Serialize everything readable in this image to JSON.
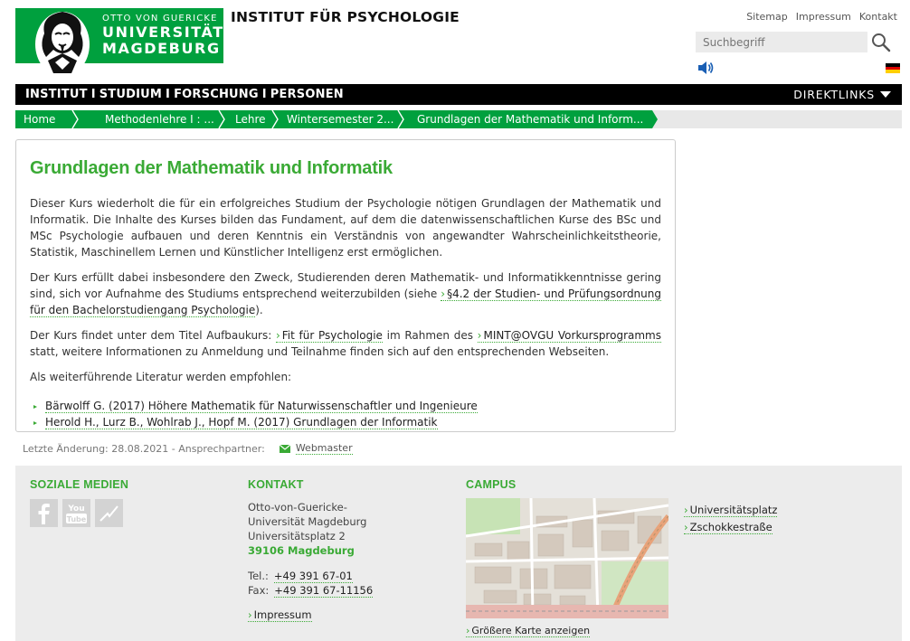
{
  "header": {
    "logo_line1": "OTTO VON GUERICKE",
    "logo_line2": "UNIVERSITÄT",
    "logo_line3": "MAGDEBURG",
    "institute_title": "INSTITUT FÜR PSYCHOLOGIE",
    "toplinks": [
      "Sitemap",
      "Impressum",
      "Kontakt"
    ],
    "search_placeholder": "Suchbegriff"
  },
  "nav": {
    "items": [
      "INSTITUT",
      "STUDIUM",
      "FORSCHUNG",
      "PERSONEN"
    ],
    "separator": "I",
    "direktlinks": "DIREKTLINKS"
  },
  "breadcrumb": [
    "Home",
    "Methodenlehre I : ...",
    "Lehre",
    "Wintersemester 2...",
    "Grundlagen der Mathematik und Inform..."
  ],
  "content": {
    "title": "Grundlagen der Mathematik und Informatik",
    "p1": "Dieser Kurs wiederholt die für ein erfolgreiches Studium der Psychologie nötigen Grundlagen der Mathematik und Informatik. Die Inhalte des Kurses bilden das Fundament, auf dem die datenwissenschaftlichen Kurse des BSc und MSc Psychologie aufbauen und deren Kenntnis ein Verständnis von angewandter Wahrscheinlichkeitstheorie, Statistik, Maschinellem Lernen und Künstlicher Intelligenz erst ermöglichen.",
    "p2_before": "Der Kurs erfüllt dabei insbesondere den Zweck, Studierenden deren Mathematik- und Informatikkenntnisse gering sind, sich vor Aufnahme des Studiums entsprechend weiterzubilden (siehe ",
    "p2_link": "§4.2 der Studien- und Prüfungsordnung für den Bachelorstudiengang Psychologie",
    "p2_after": ").",
    "p3_before": "Der Kurs findet unter dem Titel Aufbaukurs: ",
    "p3_link1": "Fit für Psychologie",
    "p3_mid": " im Rahmen des ",
    "p3_link2": "MINT@OVGU Vorkursprogramms",
    "p3_after": " statt, weitere Informationen zu Anmeldung und Teilnahme finden sich auf den entsprechenden Webseiten.",
    "p4": "Als weiterführende Literatur werden empfohlen:",
    "literature": [
      "Bärwolff G. (2017) Höhere Mathematik für Naturwissenschaftler und Ingenieure",
      "Herold H., Lurz B., Wohlrab J., Hopf M. (2017) Grundlagen der Informatik"
    ]
  },
  "meta": {
    "text": "Letzte Änderung: 28.08.2021 - Ansprechpartner:",
    "contact_link": "Webmaster"
  },
  "footer": {
    "social_title": "SOZIALE MEDIEN",
    "social_icons": [
      "facebook-icon",
      "youtube-icon",
      "rss-icon"
    ],
    "contact_title": "KONTAKT",
    "address_line1": "Otto-von-Guericke-",
    "address_line2": "Universität Magdeburg",
    "address_line3": "Universitätsplatz 2",
    "address_city": "39106 Magdeburg",
    "tel_label": "Tel.:",
    "tel_value": "+49 391 67-01",
    "fax_label": "Fax:",
    "fax_value": "+49 391 67-11156",
    "impressum": "Impressum",
    "campus_title": "CAMPUS",
    "campus_links": [
      "Universitätsplatz",
      "Zschokkestraße"
    ],
    "map_link": "Größere Karte anzeigen"
  },
  "colors": {
    "brand_green": "#00a03e",
    "link_green": "#3aaa35",
    "nav_black": "#000000",
    "footer_bg": "#ececec"
  }
}
